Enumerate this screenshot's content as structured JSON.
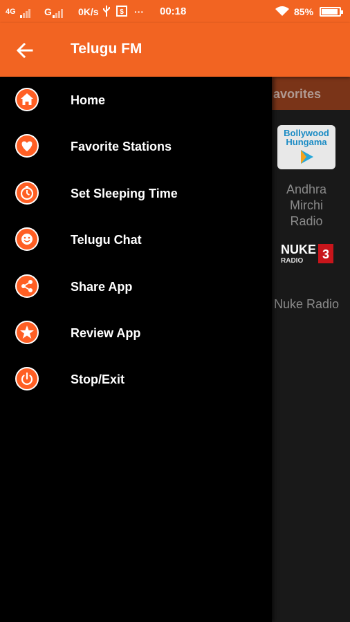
{
  "status_bar": {
    "network1": "4G",
    "network2": "G",
    "speed": "0K/s",
    "time": "00:18",
    "more": "···",
    "battery": "85%",
    "battery_level": 0.85
  },
  "app_bar": {
    "title": "Telugu FM",
    "back_icon": "arrow-left-icon"
  },
  "background": {
    "tab_label": "avorites",
    "stations": [
      {
        "name_line1": "Andhra",
        "name_line2": "Mirchi Radio",
        "logo_line1": "Bollywood",
        "logo_line2": "Hungama"
      },
      {
        "name_line1": "Nuke Radio",
        "name_line2": "",
        "logo_line1": "NUKE",
        "logo_line2": "RADIO"
      }
    ]
  },
  "drawer": {
    "items": [
      {
        "label": "Home",
        "icon": "home-icon"
      },
      {
        "label": "Favorite Stations",
        "icon": "heart-icon"
      },
      {
        "label": "Set Sleeping Time",
        "icon": "timer-icon"
      },
      {
        "label": "Telugu Chat",
        "icon": "smiley-icon"
      },
      {
        "label": "Share App",
        "icon": "share-icon"
      },
      {
        "label": "Review App",
        "icon": "star-icon"
      },
      {
        "label": "Stop/Exit",
        "icon": "power-icon"
      }
    ]
  },
  "colors": {
    "accent": "#f26422",
    "icon_fill": "#ff5f24",
    "drawer_bg": "#000000",
    "content_bg": "#191919"
  }
}
